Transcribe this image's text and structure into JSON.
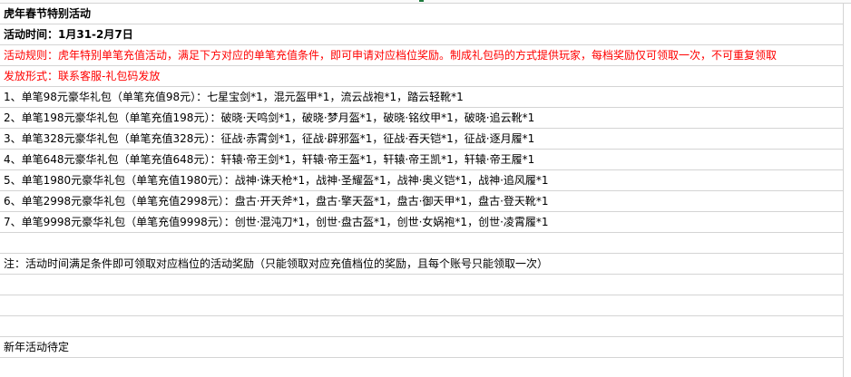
{
  "sheet": {
    "rows": [
      {
        "text": "虎年春节特别活动",
        "style": "bold"
      },
      {
        "text": "活动时间：1月31-2月7日",
        "style": "bold"
      },
      {
        "text": "活动规则：虎年特别单笔充值活动，满足下方对应的单笔充值条件，即可申请对应档位奖励。制成礼包码的方式提供玩家，每档奖励仅可领取一次，不可重复领取",
        "style": "red"
      },
      {
        "text": "发放形式：联系客服-礼包码发放",
        "style": "red"
      },
      {
        "text": "1、单笔98元豪华礼包（单笔充值98元）：七星宝剑*1，混元盔甲*1，流云战袍*1，踏云轻靴*1",
        "style": "normal"
      },
      {
        "text": "2、单笔198元豪华礼包（单笔充值198元）：破晓·天鸣剑*1，破晓·梦月盔*1，破晓·铭纹甲*1，破晓·追云靴*1",
        "style": "normal"
      },
      {
        "text": "3、单笔328元豪华礼包（单笔充值328元）：征战·赤霄剑*1，征战·辟邪盔*1，征战·吞天铠*1，征战·逐月履*1",
        "style": "normal"
      },
      {
        "text": "4、单笔648元豪华礼包（单笔充值648元）：轩辕·帝王剑*1，轩辕·帝王盔*1，轩辕·帝王凯*1，轩辕·帝王履*1",
        "style": "normal"
      },
      {
        "text": "5、单笔1980元豪华礼包（单笔充值1980元）：战神·诛天枪*1，战神·圣耀盔*1，战神·奥义铠*1，战神·追风履*1",
        "style": "normal"
      },
      {
        "text": "6、单笔2998元豪华礼包（单笔充值2998元）：盘古·开天斧*1，盘古·擎天盔*1，盘古·御天甲*1，盘古·登天靴*1",
        "style": "normal"
      },
      {
        "text": "7、单笔9998元豪华礼包（单笔充值9998元）：创世·混沌刀*1，创世·盘古盔*1，创世·女娲袍*1，创世·凌霄履*1",
        "style": "normal"
      },
      {
        "text": "",
        "style": "normal"
      },
      {
        "text": "注：活动时间满足条件即可领取对应档位的活动奖励（只能领取对应充值档位的奖励，且每个账号只能领取一次）",
        "style": "normal"
      },
      {
        "text": "",
        "style": "normal"
      },
      {
        "text": "",
        "style": "normal"
      },
      {
        "text": "",
        "style": "normal"
      },
      {
        "text": "新年活动待定",
        "style": "normal"
      }
    ]
  },
  "colors": {
    "grid": "#d4d4d4",
    "accent_red": "#ff0000",
    "marker_green": "#1d7a3c"
  }
}
